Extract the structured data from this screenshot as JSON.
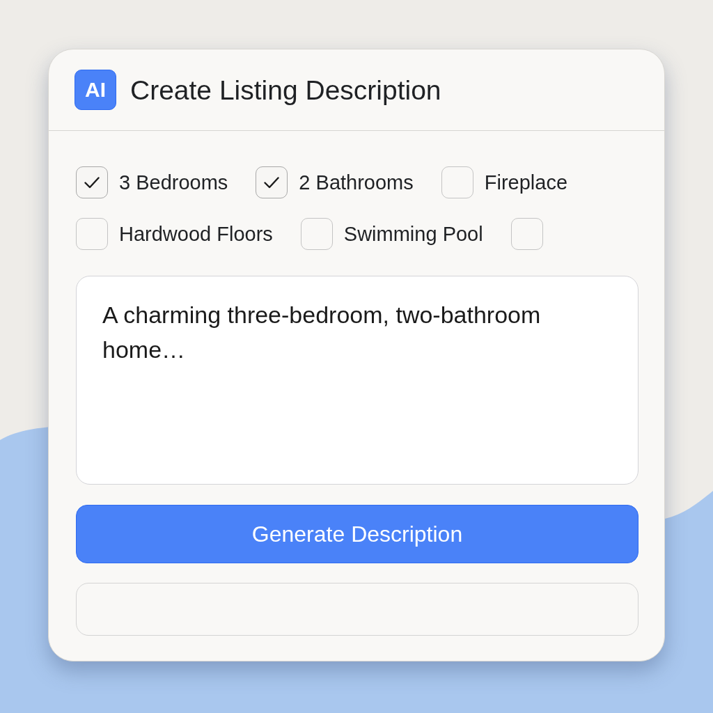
{
  "header": {
    "badge": "AI",
    "title": "Create Listing Description"
  },
  "features": [
    {
      "label": "3 Bedrooms",
      "checked": true
    },
    {
      "label": "2 Bathrooms",
      "checked": true
    },
    {
      "label": "Fireplace",
      "checked": false
    },
    {
      "label": "Hardwood Floors",
      "checked": false
    },
    {
      "label": "Swimming Pool",
      "checked": false
    },
    {
      "checked": false
    }
  ],
  "description": {
    "value": "A charming three-bedroom, two-bathroom home…"
  },
  "generate_button": {
    "label": "Generate Description"
  }
}
